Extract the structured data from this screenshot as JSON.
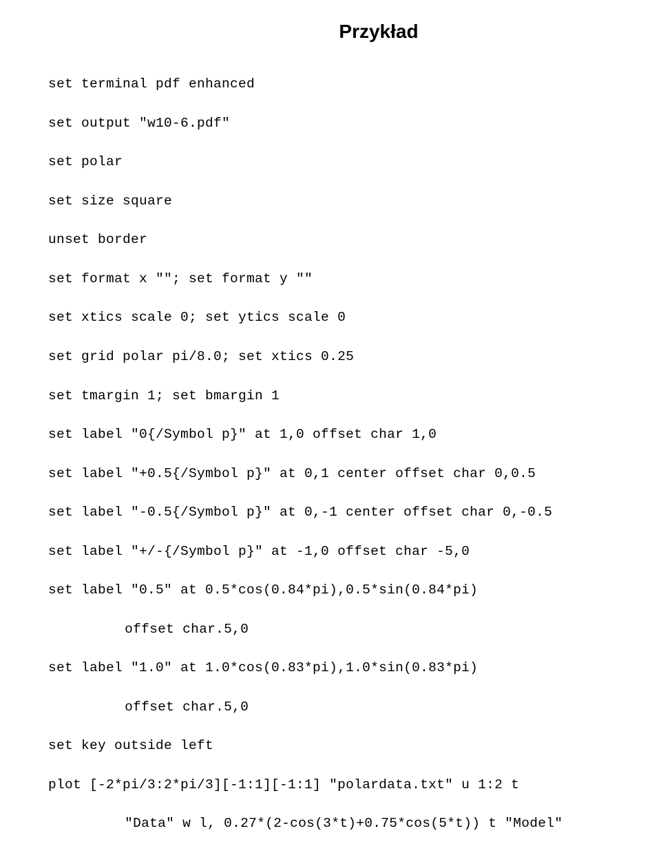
{
  "title": "Przykład",
  "code": {
    "l01": "set terminal pdf enhanced",
    "l02": "set output \"w10-6.pdf\"",
    "l03": "set polar",
    "l04": "set size square",
    "l05": "unset border",
    "l06": "set format x \"\"; set format y \"\"",
    "l07": "set xtics scale 0; set ytics scale 0",
    "l08": "set grid polar pi/8.0; set xtics 0.25",
    "l09": "set tmargin 1; set bmargin 1",
    "l10": "set label \"0{/Symbol p}\" at 1,0 offset char 1,0",
    "l11": "set label \"+0.5{/Symbol p}\" at 0,1 center offset char 0,0.5",
    "l12": "set label \"-0.5{/Symbol p}\" at 0,-1 center offset char 0,-0.5",
    "l13": "set label \"+/-{/Symbol p}\" at -1,0 offset char -5,0",
    "l14": "set label \"0.5\" at 0.5*cos(0.84*pi),0.5*sin(0.84*pi)",
    "l15": "offset char.5,0",
    "l16": "set label \"1.0\" at 1.0*cos(0.83*pi),1.0*sin(0.83*pi)",
    "l17": "offset char.5,0",
    "l18": "set key outside left",
    "l19": "plot [-2*pi/3:2*pi/3][-1:1][-1:1] \"polardata.txt\" u 1:2 t",
    "l20": "\"Data\" w l, 0.27*(2-cos(3*t)+0.75*cos(5*t)) t \"Model\""
  }
}
